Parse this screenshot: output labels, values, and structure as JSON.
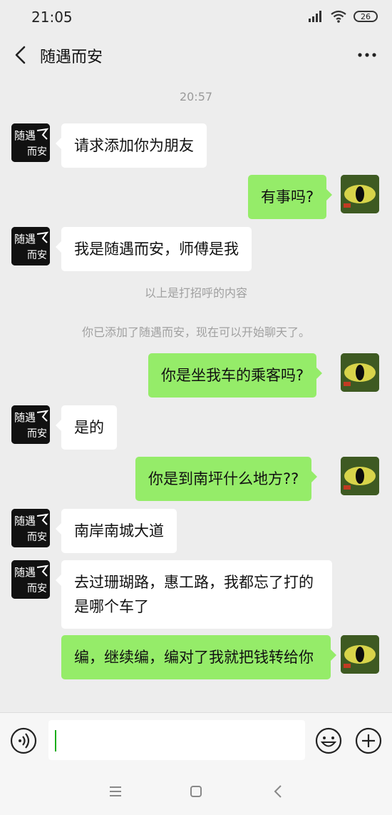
{
  "status_bar": {
    "time": "21:05",
    "battery": "26"
  },
  "header": {
    "title": "随遇而安"
  },
  "chat": {
    "timestamp": "20:57",
    "messages": [
      {
        "side": "in",
        "text": "请求添加你为朋友"
      },
      {
        "side": "out",
        "text": "有事吗?"
      },
      {
        "side": "in",
        "text": "我是随遇而安，师傅是我"
      },
      {
        "side": "out",
        "text": "你是坐我车的乘客吗?"
      },
      {
        "side": "in",
        "text": "是的"
      },
      {
        "side": "out",
        "text": "你是到南坪什么地方??"
      },
      {
        "side": "in",
        "text": "南岸南城大道"
      },
      {
        "side": "in",
        "text": "去过珊瑚路，惠工路，我都忘了打的是哪个车了"
      },
      {
        "side": "out",
        "text": "编，继续编，编对了我就把钱转给你"
      }
    ],
    "system": [
      "以上是打招呼的内容",
      "你已添加了随遇而安，现在可以开始聊天了。"
    ]
  },
  "contact_avatar": {
    "line1": "随遇",
    "line2": "而安"
  },
  "input": {
    "value": ""
  }
}
